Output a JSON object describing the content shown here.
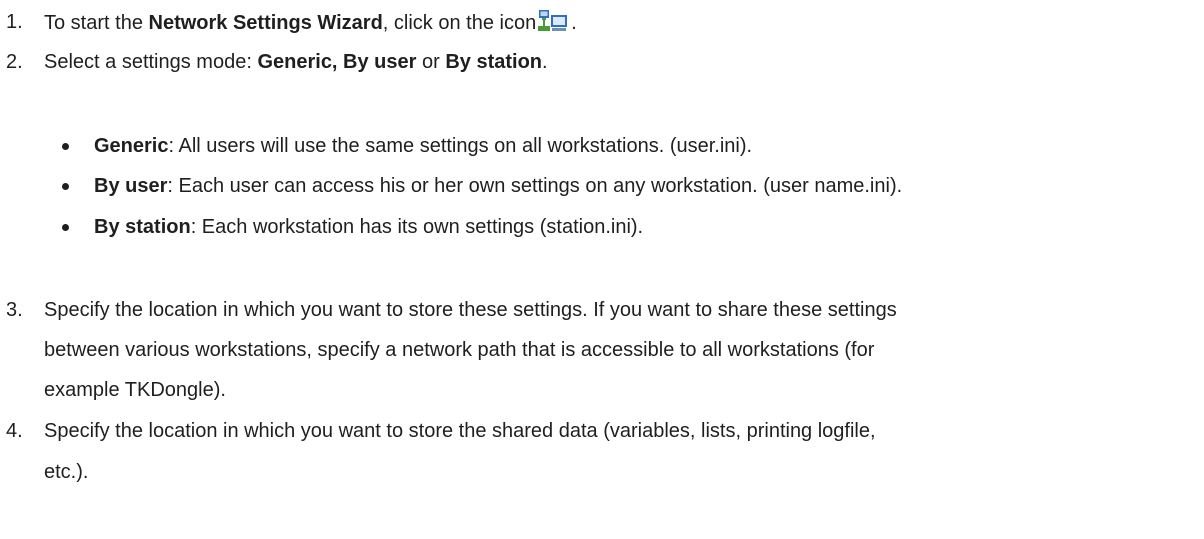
{
  "steps": [
    {
      "number": "1.",
      "pre": "To start the ",
      "bold": "Network Settings Wizard",
      "post": ", click on the icon",
      "post2": ".",
      "icon": "network-wizard-icon"
    },
    {
      "number": "2.",
      "pre": "Select a settings mode: ",
      "bold1": "Generic, By user",
      "mid": " or ",
      "bold2": "By station",
      "post": "."
    },
    {
      "number": "3.",
      "lines": [
        "Specify the location in which you want to store these settings. If you want to share these settings",
        "between various workstations, specify a network path that is accessible to all workstations (for",
        "example TKDongle)."
      ]
    },
    {
      "number": "4.",
      "lines": [
        "Specify the location in which you want to store the shared data (variables, lists, printing logfile,",
        "etc.)."
      ]
    }
  ],
  "modes": [
    {
      "name": "Generic",
      "desc": ": All users will use the same settings on all workstations. (user.ini)."
    },
    {
      "name": "By user",
      "desc": ": Each user can access his or her own settings on any workstation. (user name.ini)."
    },
    {
      "name": "By station",
      "desc": ": Each workstation has its own settings (station.ini)."
    }
  ],
  "colors": {
    "text": "#1f1f1f",
    "icon_green": "#4a9a3a",
    "icon_blue": "#2f6fc0"
  }
}
